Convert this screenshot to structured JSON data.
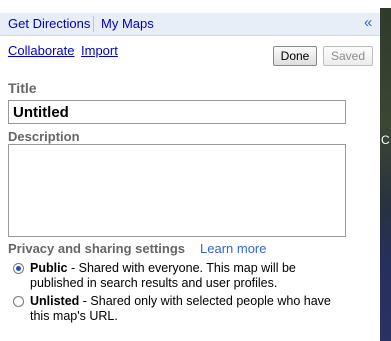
{
  "tabs": {
    "get_directions": "Get Directions",
    "my_maps": "My Maps",
    "collapse": "«"
  },
  "actions": {
    "collaborate": "Collaborate",
    "import": "Import",
    "done": "Done",
    "saved": "Saved"
  },
  "form": {
    "title_label": "Title",
    "title_value": "Untitled",
    "description_label": "Description",
    "description_value": ""
  },
  "privacy": {
    "heading": "Privacy and sharing settings",
    "learn_more": "Learn more",
    "options": [
      {
        "name": "Public",
        "desc": " - Shared with everyone. This map will be published in search results and user profiles.",
        "selected": true
      },
      {
        "name": "Unlisted",
        "desc": " - Shared only with selected people who have this map's URL.",
        "selected": false
      }
    ]
  },
  "map": {
    "edge_label": "C"
  },
  "colors": {
    "link": "#0000cc",
    "tab_bar": "#e8eef7",
    "label_gray": "#666666",
    "radio_selected": "#1f4fbf"
  }
}
